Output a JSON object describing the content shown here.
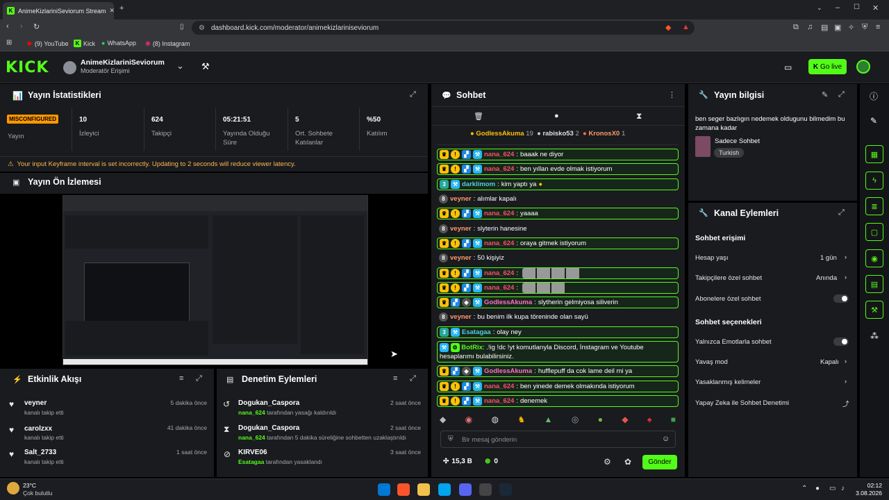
{
  "browser": {
    "tab_title": "AnimeKizlariniSeviorum Stream",
    "url": "dashboard.kick.com/moderator/animekizlariniseviorum",
    "bookmarks": [
      "(9) YouTube",
      "Kick",
      "WhatsApp",
      "(8) Instagram"
    ]
  },
  "header": {
    "logo": "KICK",
    "channel_name": "AnimeKizlariniSeviorum",
    "role": "Moderatör Erişimi",
    "go_live": "Go live"
  },
  "stats": {
    "title": "Yayın İstatistikleri",
    "status_badge": "MISCONFIGURED",
    "status_label": "Yayın",
    "items": [
      {
        "value": "10",
        "label": "İzleyici"
      },
      {
        "value": "624",
        "label": "Takipçi"
      },
      {
        "value": "05:21:51",
        "label": "Yayında Olduğu Süre"
      },
      {
        "value": "5",
        "label": "Ort. Sohbete Katılanlar"
      },
      {
        "value": "%50",
        "label": "Katılım"
      }
    ],
    "warning": "Your input Keyframe interval is set incorrectly. Updating to 2 seconds will reduce viewer latency."
  },
  "preview": {
    "title": "Yayın Ön İzlemesi"
  },
  "activity": {
    "title": "Etkinlik Akışı",
    "items": [
      {
        "name": "veyner",
        "sub": "kanalı takip etti",
        "time": "5 dakika önce"
      },
      {
        "name": "carolzxx",
        "sub": "kanalı takip etti",
        "time": "41 dakika önce"
      },
      {
        "name": "Salt_2733",
        "sub": "kanalı takip etti",
        "time": "1 saat önce"
      }
    ]
  },
  "moderation": {
    "title": "Denetim Eylemleri",
    "items": [
      {
        "name": "Dogukan_Caspora",
        "actor": "nana_624",
        "sub": "tarafından yasağı kaldırıldı",
        "time": "2 saat önce"
      },
      {
        "name": "Dogukan_Caspora",
        "actor": "nana_624",
        "sub": "tarafından 5 dakika süreliğine sohbetten uzaklaştırıldı",
        "time": "2 saat önce"
      },
      {
        "name": "KIRVE06",
        "actor": "Esatagaa",
        "sub": "tarafından yasaklandı",
        "time": "3 saat önce"
      }
    ]
  },
  "chat": {
    "title": "Sohbet",
    "top_gifters": [
      {
        "name": "GodlessAkuma",
        "count": "19"
      },
      {
        "name": "rabisko53",
        "count": "2"
      },
      {
        "name": "KronosX0",
        "count": "1"
      }
    ],
    "messages": [
      {
        "user": "nana_624",
        "text": "baaak ne diyor"
      },
      {
        "user": "nana_624",
        "text": "ben yıllan evde olmak istiyorum"
      },
      {
        "user": "darklimom",
        "text": "kim yaptı ya"
      },
      {
        "user": "veyner",
        "text": "alımlar kapalı"
      },
      {
        "user": "nana_624",
        "text": "yaaaa"
      },
      {
        "user": "veyner",
        "text": "slyterin hanesine"
      },
      {
        "user": "nana_624",
        "text": "oraya gitmek istiyorum"
      },
      {
        "user": "veyner",
        "text": "50 kişiyiz"
      },
      {
        "user": "nana_624",
        "text": ""
      },
      {
        "user": "nana_624",
        "text": ""
      },
      {
        "user": "GodlessAkuma",
        "text": "slytherin gelmiyosa siliverin"
      },
      {
        "user": "veyner",
        "text": "bu benim ilk kupa töreninde olan sayü"
      },
      {
        "user": "Esatagaa",
        "text": "olay ney"
      },
      {
        "user": "BotRix",
        "text": ".!ig !dc !yt komutlarıyla Discord, İnstagram ve Youtube hesaplarımı bulabilirsiniz."
      },
      {
        "user": "GodlessAkuma",
        "text": "hufflepuff da cok lame deil mi ya"
      },
      {
        "user": "nana_624",
        "text": "ben yinede demek olmakında istiyorum"
      },
      {
        "user": "nana_624",
        "text": "denemek"
      }
    ],
    "input_placeholder": "Bir mesaj gönderin",
    "points": "15,3 B",
    "kicks": "0",
    "send": "Gönder"
  },
  "stream_info": {
    "title": "Yayın bilgisi",
    "stream_title": "ben seger bazlıgın nedemek oldugunu bilmedim bu zamana kadar",
    "category": "Sadece Sohbet",
    "tag": "Turkish"
  },
  "channel_actions": {
    "title": "Kanal Eylemleri",
    "chat_access": "Sohbet erişimi",
    "account_age": {
      "label": "Hesap yaşı",
      "value": "1 gün"
    },
    "follower_chat": {
      "label": "Takipçilere özel sohbet",
      "value": "Anında"
    },
    "sub_chat": "Abonelere özel sohbet",
    "chat_options": "Sohbet seçenekleri",
    "emote_only": "Yalnızca Emotlarla sohbet",
    "slow_mode": {
      "label": "Yavaş mod",
      "value": "Kapalı"
    },
    "banned_words": "Yasaklanmış kelimeler",
    "ai_moderation": "Yapay Zeka ile Sohbet Denetimi"
  },
  "taskbar": {
    "temp": "23°C",
    "weather": "Çok bulutlu",
    "time": "02:12",
    "date": "3.08.2026"
  }
}
